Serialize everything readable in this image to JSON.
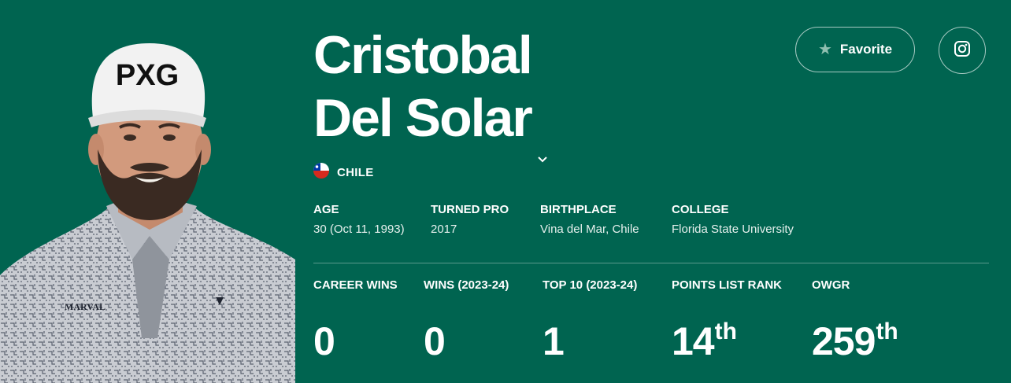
{
  "player": {
    "first_name": "Cristobal",
    "last_name": "Del Solar",
    "country": "CHILE"
  },
  "actions": {
    "favorite_label": "Favorite"
  },
  "icons": {
    "favorite": "star-icon",
    "social": "instagram-icon",
    "name_menu": "chevron-down-icon",
    "country": "chile-flag-icon"
  },
  "colors": {
    "background": "#006450",
    "text": "#ffffff"
  },
  "bio": [
    {
      "label": "AGE",
      "value": "30 (Oct 11, 1993)"
    },
    {
      "label": "TURNED PRO",
      "value": "2017"
    },
    {
      "label": "BIRTHPLACE",
      "value": "Vina del Mar, Chile"
    },
    {
      "label": "COLLEGE",
      "value": "Florida State University"
    }
  ],
  "stats": [
    {
      "label": "CAREER WINS",
      "value": "0",
      "suffix": ""
    },
    {
      "label": "WINS (2023-24)",
      "value": "0",
      "suffix": ""
    },
    {
      "label": "TOP 10 (2023-24)",
      "value": "1",
      "suffix": ""
    },
    {
      "label": "POINTS LIST RANK",
      "value": "14",
      "suffix": "th"
    },
    {
      "label": "OWGR",
      "value": "259",
      "suffix": "th"
    }
  ],
  "photo": {
    "cap_logo": "PXG",
    "shirt_logo": "MARVAL"
  }
}
